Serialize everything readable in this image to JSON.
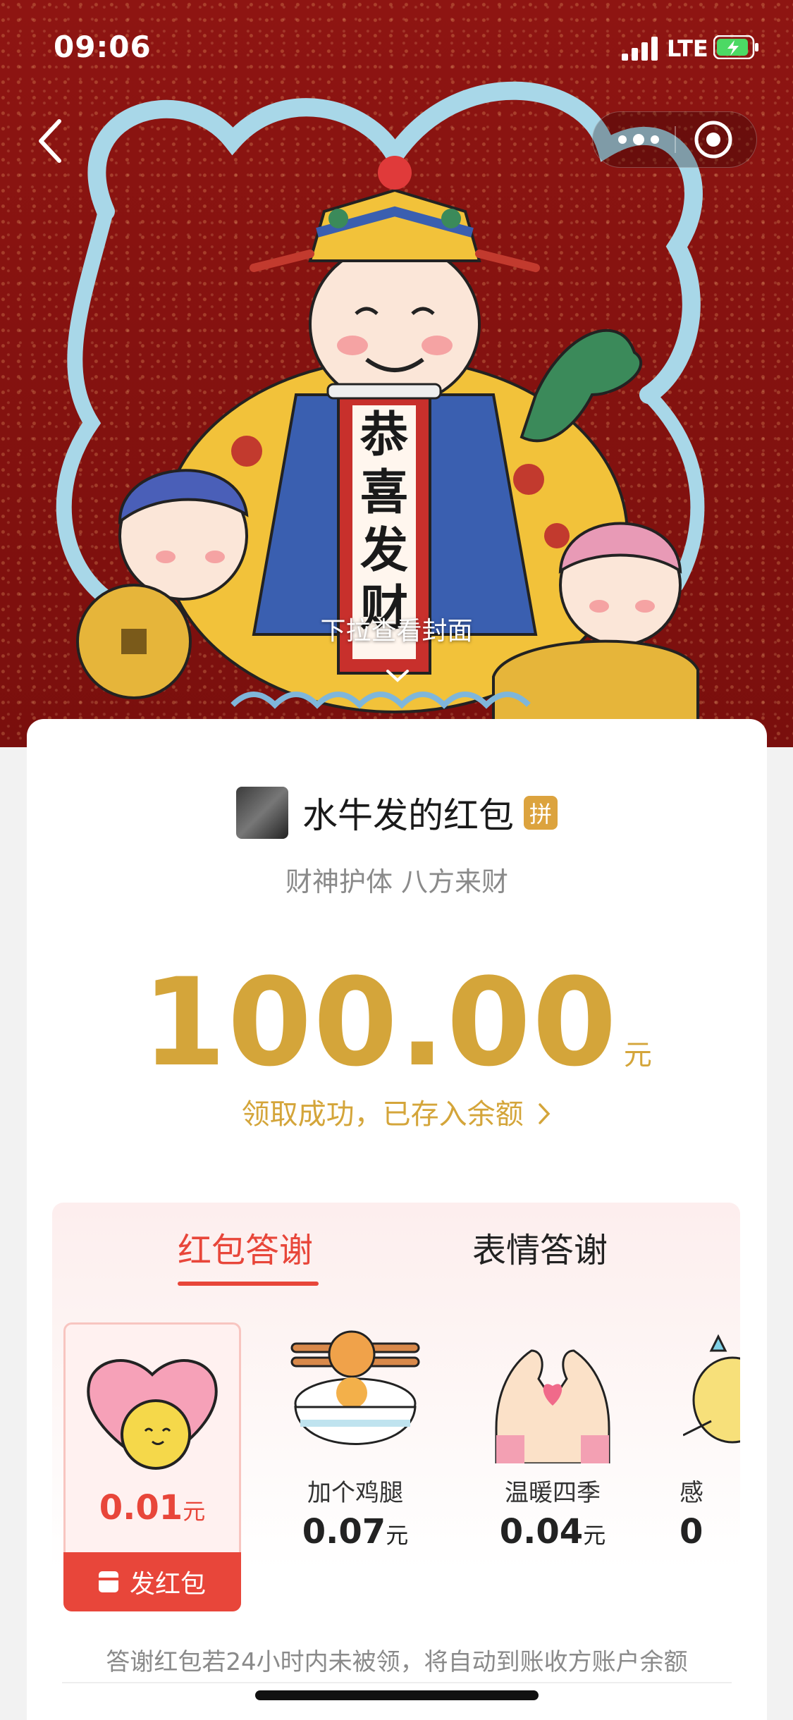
{
  "status_bar": {
    "time": "09:06",
    "network": "LTE"
  },
  "cover": {
    "scroll_text": "恭喜发财",
    "pull_hint": "下拉查看封面"
  },
  "card": {
    "sender_name": "水牛发的红包",
    "badge": "拼",
    "blessing": "财神护体 八方来财",
    "amount": "100.00",
    "unit": "元",
    "status": "领取成功，已存入余额"
  },
  "thanks": {
    "tabs": [
      "红包答谢",
      "表情答谢"
    ],
    "items": [
      {
        "name": "",
        "price": "0.01",
        "unit": "元",
        "button": "发红包"
      },
      {
        "name": "加个鸡腿",
        "price": "0.07",
        "unit": "元"
      },
      {
        "name": "温暖四季",
        "price": "0.04",
        "unit": "元"
      },
      {
        "name": "感",
        "price": "0"
      }
    ],
    "note": "答谢红包若24小时内未被领，将自动到账收方账户余额"
  },
  "icons": [
    "back-icon",
    "more-icon",
    "target-icon",
    "chevron-down-icon",
    "chevron-right-icon",
    "red-packet-icon"
  ],
  "colors": {
    "accent_red": "#e8463a",
    "gold": "#d4a53a",
    "cover_red": "#8e1512"
  }
}
